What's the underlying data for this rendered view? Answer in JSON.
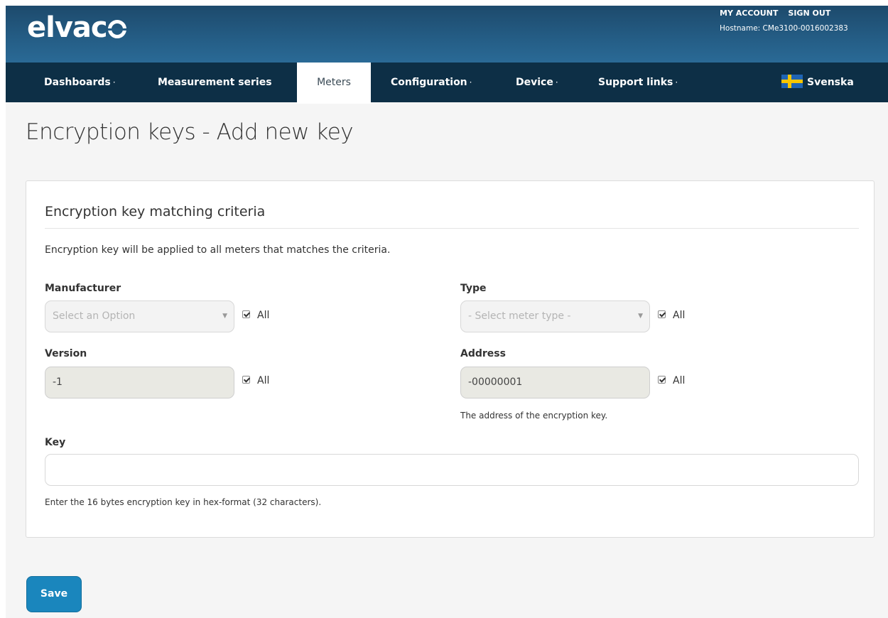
{
  "header": {
    "logo_text": "elvac",
    "my_account": "MY ACCOUNT",
    "sign_out": "SIGN OUT",
    "hostname": "Hostname: CMe3100-0016002383",
    "brand_color": "#245c84"
  },
  "nav": {
    "items": [
      {
        "label": "Dashboards",
        "caret": "·"
      },
      {
        "label": "Measurement series"
      },
      {
        "label": "Meters",
        "active": true
      },
      {
        "label": "Configuration",
        "caret": "·"
      },
      {
        "label": "Device",
        "caret": "·"
      },
      {
        "label": "Support links",
        "caret": "·"
      }
    ],
    "language": "Svenska"
  },
  "page": {
    "title": "Encryption keys - Add new key"
  },
  "form": {
    "section_title": "Encryption key matching criteria",
    "description": "Encryption key will be applied to all meters that matches the criteria.",
    "manufacturer": {
      "label": "Manufacturer",
      "placeholder": "Select an Option",
      "all_label": "All",
      "all_checked": true
    },
    "type": {
      "label": "Type",
      "placeholder": "- Select meter type -",
      "all_label": "All",
      "all_checked": true
    },
    "version": {
      "label": "Version",
      "value": "-1",
      "all_label": "All",
      "all_checked": true
    },
    "address": {
      "label": "Address",
      "value": "-00000001",
      "all_label": "All",
      "all_checked": true,
      "help": "The address of the encryption key."
    },
    "key": {
      "label": "Key",
      "value": "",
      "help": "Enter the 16 bytes encryption key in hex-format (32 characters)."
    },
    "save_label": "Save"
  }
}
